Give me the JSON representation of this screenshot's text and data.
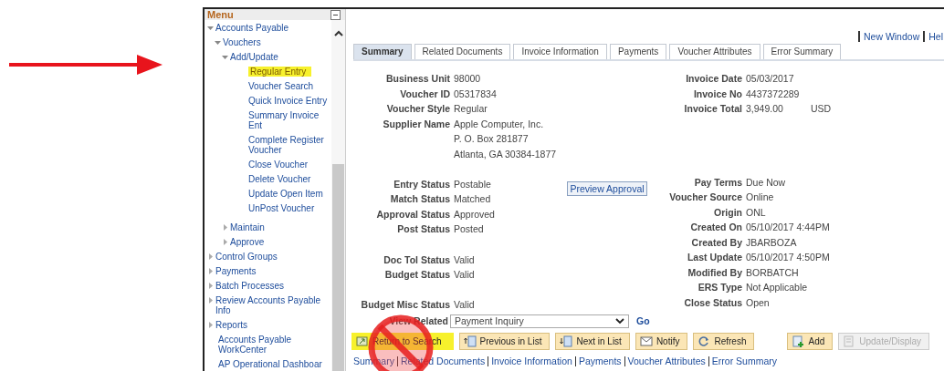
{
  "menu": {
    "title": "Menu",
    "items": [
      {
        "label": "Accounts Payable",
        "kind": "folder",
        "expanded": true,
        "children": [
          {
            "label": "Vouchers",
            "kind": "folder",
            "expanded": true,
            "children": [
              {
                "label": "Add/Update",
                "kind": "folder",
                "expanded": true,
                "children": [
                  {
                    "label": "Regular Entry",
                    "kind": "link",
                    "highlighted": true
                  },
                  {
                    "label": "Voucher Search",
                    "kind": "link",
                    "highlighted": false
                  },
                  {
                    "label": "Quick Invoice Entry",
                    "kind": "link",
                    "highlighted": false
                  },
                  {
                    "label": "Summary Invoice Ent",
                    "kind": "link",
                    "highlighted": false
                  },
                  {
                    "label": "Complete Register Voucher",
                    "kind": "link",
                    "highlighted": false
                  },
                  {
                    "label": "Close Voucher",
                    "kind": "link",
                    "highlighted": false
                  },
                  {
                    "label": "Delete Voucher",
                    "kind": "link",
                    "highlighted": false
                  },
                  {
                    "label": "Update Open Item",
                    "kind": "link",
                    "highlighted": false
                  },
                  {
                    "label": "UnPost Voucher",
                    "kind": "link",
                    "highlighted": false
                  }
                ]
              },
              {
                "label": "Maintain",
                "kind": "folder",
                "expanded": false
              },
              {
                "label": "Approve",
                "kind": "folder",
                "expanded": false
              }
            ]
          }
        ]
      },
      {
        "label": "Control Groups",
        "kind": "folder",
        "expanded": false
      },
      {
        "label": "Payments",
        "kind": "folder",
        "expanded": false
      },
      {
        "label": "Batch Processes",
        "kind": "folder",
        "expanded": false
      },
      {
        "label": "Review Accounts Payable Info",
        "kind": "folder",
        "expanded": false
      },
      {
        "label": "Reports",
        "kind": "folder",
        "expanded": false
      },
      {
        "label": "Accounts Payable WorkCenter",
        "kind": "link",
        "highlighted": false
      },
      {
        "label": "AP Operational Dashboar",
        "kind": "link",
        "highlighted": false
      }
    ]
  },
  "header_links": [
    "New Window",
    "Hel"
  ],
  "tabs": [
    {
      "label": "Summary",
      "selected": true
    },
    {
      "label": "Related Documents",
      "selected": false
    },
    {
      "label": "Invoice Information",
      "selected": false
    },
    {
      "label": "Payments",
      "selected": false
    },
    {
      "label": "Voucher Attributes",
      "selected": false
    },
    {
      "label": "Error Summary",
      "selected": false
    }
  ],
  "left_fields": [
    [
      {
        "label": "Business Unit",
        "value": "98000"
      },
      {
        "label": "Voucher ID",
        "value": "05317834"
      },
      {
        "label": "Voucher Style",
        "value": "Regular"
      },
      {
        "label": "Supplier Name",
        "value": "Apple Computer, Inc.",
        "extra_lines": [
          "P. O. Box 281877",
          "Atlanta, GA  30384-1877"
        ]
      }
    ],
    [
      {
        "label": "Entry Status",
        "value": "Postable"
      },
      {
        "label": "Match Status",
        "value": "Matched"
      },
      {
        "label": "Approval Status",
        "value": "Approved"
      },
      {
        "label": "Post Status",
        "value": "Posted"
      }
    ],
    [
      {
        "label": "Doc Tol Status",
        "value": "Valid"
      },
      {
        "label": "Budget Status",
        "value": "Valid"
      }
    ],
    [
      {
        "label": "Budget Misc Status",
        "value": "Valid"
      }
    ]
  ],
  "preview_button": "Preview Approval",
  "right_fields": [
    [
      {
        "label": "Invoice Date",
        "value": "05/03/2017"
      },
      {
        "label": "Invoice No",
        "value": "4437372289"
      },
      {
        "label": "Invoice Total",
        "value": "3,949.00",
        "unit": "USD"
      }
    ],
    [
      {
        "label": "Pay Terms",
        "value": "Due Now"
      },
      {
        "label": "Voucher Source",
        "value": "Online"
      },
      {
        "label": "Origin",
        "value": "ONL"
      },
      {
        "label": "Created On",
        "value": "05/10/2017  4:44PM"
      },
      {
        "label": "Created By",
        "value": "JBARBOZA"
      },
      {
        "label": "Last Update",
        "value": "05/10/2017  4:50PM"
      },
      {
        "label": "Modified By",
        "value": "BORBATCH"
      },
      {
        "label": "ERS Type",
        "value": "Not Applicable"
      },
      {
        "label": "Close Status",
        "value": "Open"
      }
    ]
  ],
  "view_related": {
    "label": "View Related",
    "value": "Payment Inquiry",
    "go": "Go"
  },
  "buttons": [
    {
      "label": "Return to Search",
      "kind": "return",
      "highlighted": true,
      "disabled": false
    },
    {
      "label": "Previous in List",
      "kind": "previous",
      "highlighted": false,
      "disabled": false
    },
    {
      "label": "Next in List",
      "kind": "next",
      "highlighted": false,
      "disabled": false
    },
    {
      "label": "Notify",
      "kind": "notify",
      "highlighted": false,
      "disabled": false
    },
    {
      "label": "Refresh",
      "kind": "refresh",
      "highlighted": false,
      "disabled": false
    },
    {
      "label": "Add",
      "kind": "add",
      "highlighted": false,
      "disabled": false
    },
    {
      "label": "Update/Display",
      "kind": "update",
      "highlighted": false,
      "disabled": true
    }
  ],
  "footer_links": [
    "Summary",
    "Related Documents",
    "Invoice Information",
    "Payments",
    "Voucher Attributes",
    "Error Summary"
  ]
}
